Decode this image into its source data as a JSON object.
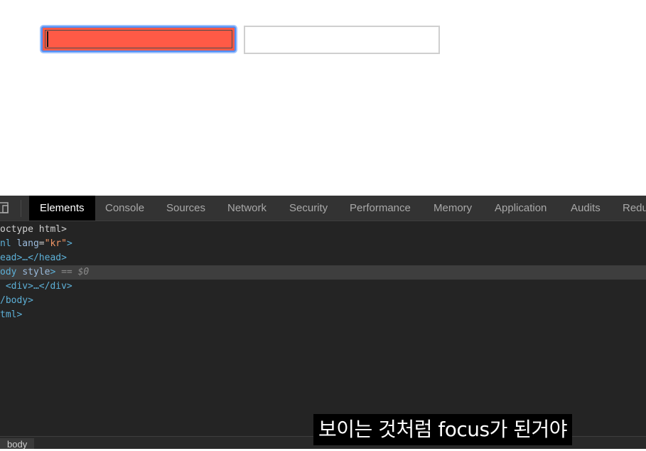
{
  "page": {
    "inputs": [
      {
        "value": "",
        "state": "focused",
        "background": "#ff5a46",
        "focus_ring": "#4d8cf5"
      },
      {
        "value": "",
        "state": "default",
        "border": "#cfcfcf"
      }
    ]
  },
  "devtools": {
    "tabs": [
      "Elements",
      "Console",
      "Sources",
      "Network",
      "Security",
      "Performance",
      "Memory",
      "Application",
      "Audits",
      "Redu"
    ],
    "active_tab": "Elements",
    "tree": {
      "doctype": "octype html>",
      "html_tag": "nl",
      "html_attr": "lang",
      "html_val": "\"kr\"",
      "head": "ead>…</head>",
      "body_tag": "ody",
      "body_attr": "style",
      "body_suffix": "== $0",
      "div": "<div>…</div>",
      "body_close": "/body>",
      "html_close": "tml>"
    },
    "breadcrumb": "body",
    "colors": {
      "panel": "#242424",
      "tabbar": "#333333",
      "selected_row": "#3e3e3e",
      "tag": "#5db0d7",
      "value": "#f29766"
    }
  },
  "subtitle": "보이는 것처럼 focus가 된거야"
}
